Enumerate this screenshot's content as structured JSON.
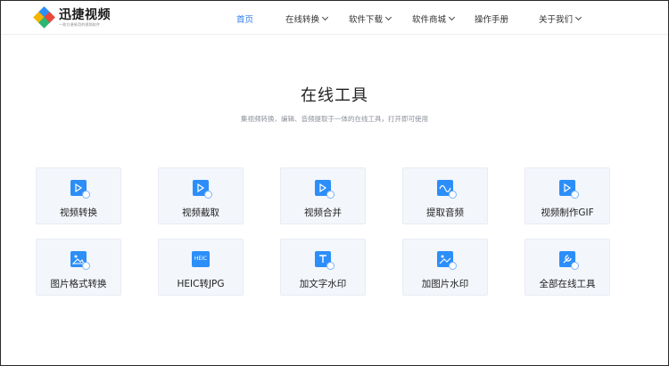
{
  "brand": {
    "name": "迅捷视频",
    "slogan": "一款方便易用的视频软件"
  },
  "nav": [
    {
      "label": "首页",
      "active": true,
      "dropdown": false
    },
    {
      "label": "在线转换",
      "active": false,
      "dropdown": true
    },
    {
      "label": "软件下载",
      "active": false,
      "dropdown": true
    },
    {
      "label": "软件商城",
      "active": false,
      "dropdown": true
    },
    {
      "label": "操作手册",
      "active": false,
      "dropdown": false
    },
    {
      "label": "关于我们",
      "active": false,
      "dropdown": true
    }
  ],
  "hero": {
    "title": "在线工具",
    "subtitle": "集视频转换、编辑、音频提取于一体的在线工具，打开即可使用"
  },
  "tools": [
    {
      "label": "视频转换",
      "icon": "video-convert-icon"
    },
    {
      "label": "视频截取",
      "icon": "video-clip-icon"
    },
    {
      "label": "视频合并",
      "icon": "video-merge-icon"
    },
    {
      "label": "提取音频",
      "icon": "audio-extract-icon"
    },
    {
      "label": "视频制作GIF",
      "icon": "video-gif-icon"
    },
    {
      "label": "图片格式转换",
      "icon": "image-convert-icon"
    },
    {
      "label": "HEIC转JPG",
      "icon": "heic-icon",
      "icon_text": "HEIC"
    },
    {
      "label": "加文字水印",
      "icon": "text-watermark-icon"
    },
    {
      "label": "加图片水印",
      "icon": "image-watermark-icon"
    },
    {
      "label": "全部在线工具",
      "icon": "all-tools-icon"
    }
  ],
  "colors": {
    "accent": "#2f7ef0",
    "icon_bg": "#2c8ef8",
    "card_bg": "#f3f6fb"
  }
}
